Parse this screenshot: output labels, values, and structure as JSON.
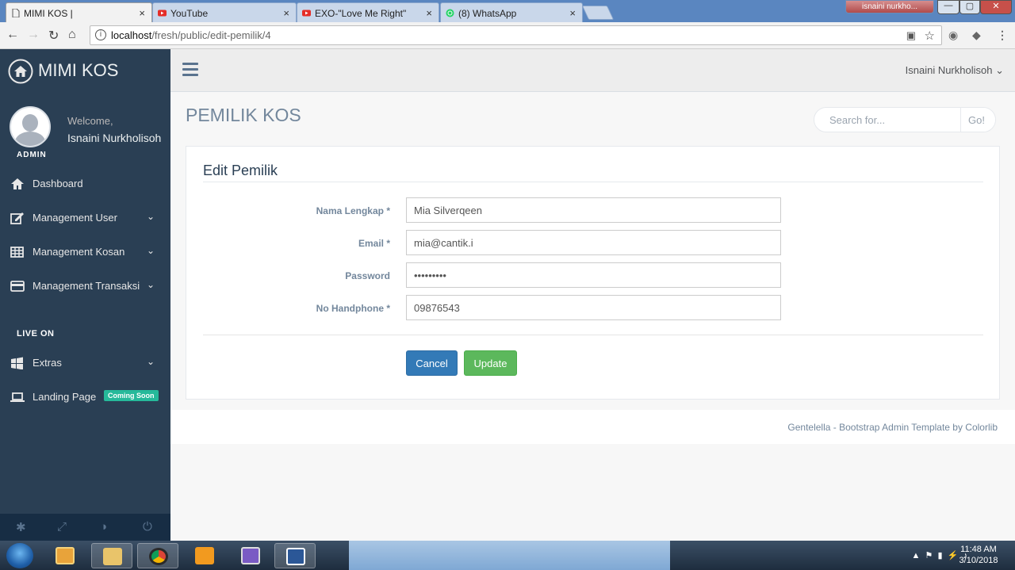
{
  "browser": {
    "tabs": [
      {
        "label": "MIMI KOS |",
        "close": "×"
      },
      {
        "label": "YouTube",
        "close": "×"
      },
      {
        "label": "EXO-\"Love Me Right\"",
        "close": "×"
      },
      {
        "label": "(8) WhatsApp",
        "close": "×"
      }
    ],
    "user_caption": "isnaini nurkho...",
    "window_buttons": {
      "minimize": "—",
      "maximize": "▢",
      "close": "✕"
    },
    "url_host": "localhost",
    "url_path": "/fresh/public/edit-pemilik/4",
    "info_glyph": "i"
  },
  "sidebar": {
    "brand": "MIMI KOS",
    "welcome": "Welcome,",
    "user_name": "Isnaini Nurkholisoh",
    "role": "ADMIN",
    "menu": [
      {
        "label": "Dashboard",
        "icon": "home-icon"
      },
      {
        "label": "Management User",
        "icon": "edit-icon"
      },
      {
        "label": "Management Kosan",
        "icon": "table-icon"
      },
      {
        "label": "Management Transaksi",
        "icon": "credit-card-icon"
      }
    ],
    "section_label": "LIVE ON",
    "live_menu": [
      {
        "label": "Extras",
        "icon": "windows-icon"
      },
      {
        "label": "Landing Page",
        "icon": "laptop-icon",
        "badge": "Coming Soon"
      }
    ]
  },
  "topnav": {
    "user": "Isnaini Nurkholisoh"
  },
  "page": {
    "title": "PEMILIK KOS",
    "search_placeholder": "Search for...",
    "search_go": "Go!"
  },
  "form": {
    "title": "Edit Pemilik",
    "fields": [
      {
        "label": "Nama Lengkap *",
        "value": "Mia Silverqeen"
      },
      {
        "label": "Email *",
        "value": "mia@cantik.i"
      },
      {
        "label": "Password",
        "value": "•••••••••"
      },
      {
        "label": "No Handphone *",
        "value": "09876543"
      }
    ],
    "cancel": "Cancel",
    "update": "Update"
  },
  "footer": "Gentelella - Bootstrap Admin Template by Colorlib",
  "taskbar": {
    "time": "11:48 AM",
    "date": "3/10/2018"
  },
  "colors": {
    "sidebar": "#2A3F54",
    "cancel": "#337AB7",
    "update": "#5CB85C",
    "badge": "#26B99A"
  }
}
